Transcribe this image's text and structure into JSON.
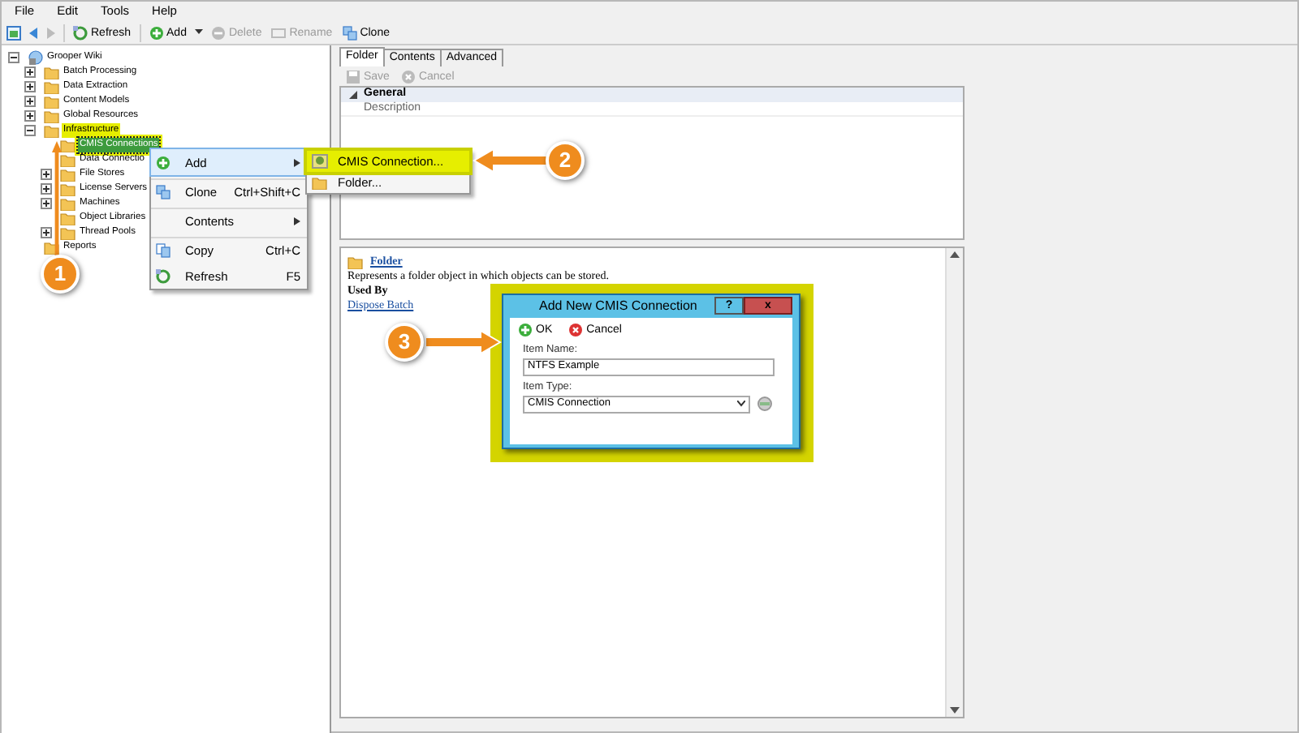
{
  "menu_bar": [
    "File",
    "Edit",
    "Tools",
    "Help"
  ],
  "toolbar": [
    {
      "kind": "home",
      "disabled": false
    },
    {
      "kind": "back",
      "disabled": false
    },
    {
      "kind": "forward",
      "disabled": true
    },
    {
      "kind": "refresh",
      "label": "Refresh",
      "disabled": false
    },
    {
      "kind": "add",
      "label": "Add",
      "disabled": false,
      "dropdown": true
    },
    {
      "kind": "delete",
      "label": "Delete",
      "disabled": true
    },
    {
      "kind": "rename",
      "label": "Rename",
      "disabled": true
    },
    {
      "kind": "clone",
      "label": "Clone",
      "disabled": false
    }
  ],
  "tree": [
    {
      "label": "Grooper Wiki",
      "expanded": true,
      "selected": false,
      "highlighted": false,
      "children": [
        {
          "label": "Batch Processing",
          "expanded": false,
          "selected": false,
          "highlighted": false
        },
        {
          "label": "Data Extraction",
          "expanded": false,
          "selected": false,
          "highlighted": false
        },
        {
          "label": "Content Models",
          "expanded": false,
          "selected": false,
          "highlighted": false
        },
        {
          "label": "Global Resources",
          "expanded": false,
          "selected": false,
          "highlighted": false
        },
        {
          "label": "Infrastructure",
          "expanded": true,
          "selected": false,
          "highlighted": true,
          "children": [
            {
              "label": "CMIS Connections",
              "selected": true,
              "highlighted": true
            },
            {
              "label": "Data Connectio",
              "selected": false,
              "highlighted": false
            },
            {
              "label": "File Stores",
              "expanded": false,
              "selected": false,
              "highlighted": false
            },
            {
              "label": "License Servers",
              "expanded": false,
              "selected": false,
              "highlighted": false
            },
            {
              "label": "Machines",
              "expanded": false,
              "selected": false,
              "highlighted": false
            },
            {
              "label": "Object Libraries",
              "selected": false,
              "highlighted": false
            },
            {
              "label": "Thread Pools",
              "expanded": false,
              "selected": false,
              "highlighted": false
            }
          ]
        },
        {
          "label": "Reports",
          "selected": false,
          "highlighted": false
        }
      ]
    }
  ],
  "tabs": [
    {
      "label": "Folder",
      "selected": true
    },
    {
      "label": "Contents",
      "selected": false
    },
    {
      "label": "Advanced",
      "selected": false
    }
  ],
  "panel_toolbar": [
    {
      "kind": "save",
      "label": "Save",
      "disabled": true
    },
    {
      "kind": "cancel",
      "label": "Cancel",
      "disabled": true
    }
  ],
  "property_grid": {
    "category": "General",
    "expanded": true,
    "rows": [
      {
        "name": "Description"
      }
    ]
  },
  "detail": {
    "title": "Folder",
    "description": "Represents a folder object in which objects can be stored.",
    "used_by_label": "Used By",
    "used_by": [
      "Dispose Batch"
    ]
  },
  "context_menu": [
    {
      "label": "Add",
      "kind": "add",
      "submenu": true,
      "selected": true,
      "separator_before": false
    },
    {
      "label": "Clone",
      "shortcut": "Ctrl+Shift+C",
      "kind": "clone",
      "submenu": false,
      "selected": false,
      "separator_before": true
    },
    {
      "label": "Contents",
      "kind": "none",
      "submenu": true,
      "selected": false,
      "separator_before": true
    },
    {
      "label": "Copy",
      "shortcut": "Ctrl+C",
      "kind": "copy",
      "submenu": false,
      "selected": false,
      "separator_before": true
    },
    {
      "label": "Refresh",
      "shortcut": "F5",
      "kind": "refresh",
      "submenu": false,
      "selected": false,
      "separator_before": false
    }
  ],
  "submenu": [
    {
      "label": "CMIS Connection...",
      "kind": "cmis",
      "selected": true,
      "highlighted": true
    },
    {
      "label": "Folder...",
      "kind": "folder",
      "selected": false,
      "highlighted": false
    }
  ],
  "dialog": {
    "title": "Add New CMIS Connection",
    "help": "?",
    "close": "x",
    "highlighted": true,
    "buttons": [
      {
        "label": "OK",
        "kind": "ok"
      },
      {
        "label": "Cancel",
        "kind": "cancel"
      }
    ],
    "fields": [
      {
        "label": "Item Name:",
        "kind": "text",
        "value": "NTFS Example"
      },
      {
        "label": "Item Type:",
        "kind": "select",
        "value": "CMIS Connection"
      }
    ]
  },
  "callouts": [
    {
      "number": "1"
    },
    {
      "number": "2"
    },
    {
      "number": "3"
    }
  ]
}
